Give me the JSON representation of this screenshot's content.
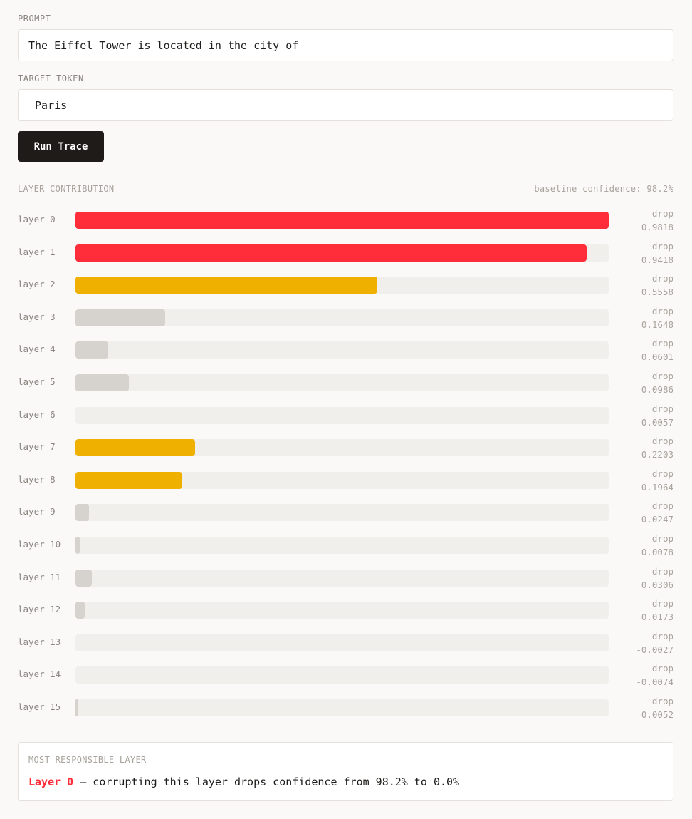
{
  "prompt": {
    "label": "PROMPT",
    "value": "The Eiffel Tower is located in the city of"
  },
  "target": {
    "label": "TARGET TOKEN",
    "value": " Paris"
  },
  "run_button": "Run Trace",
  "contribution": {
    "title": "LAYER CONTRIBUTION",
    "baseline": "baseline confidence: 98.2%",
    "drop_label": "drop",
    "max_drop": 0.9818,
    "colors": {
      "high": "#ff2d3a",
      "medium": "#f0b000",
      "low": "#d6d2ce",
      "track": "#f1efec"
    },
    "layers": [
      {
        "label": "layer 0",
        "drop": "0.9818",
        "value": 0.9818,
        "level": "high"
      },
      {
        "label": "layer 1",
        "drop": "0.9418",
        "value": 0.9418,
        "level": "high"
      },
      {
        "label": "layer 2",
        "drop": "0.5558",
        "value": 0.5558,
        "level": "medium"
      },
      {
        "label": "layer 3",
        "drop": "0.1648",
        "value": 0.1648,
        "level": "low"
      },
      {
        "label": "layer 4",
        "drop": "0.0601",
        "value": 0.0601,
        "level": "low"
      },
      {
        "label": "layer 5",
        "drop": "0.0986",
        "value": 0.0986,
        "level": "low"
      },
      {
        "label": "layer 6",
        "drop": "-0.0057",
        "value": -0.0057,
        "level": "low"
      },
      {
        "label": "layer 7",
        "drop": "0.2203",
        "value": 0.2203,
        "level": "medium"
      },
      {
        "label": "layer 8",
        "drop": "0.1964",
        "value": 0.1964,
        "level": "medium"
      },
      {
        "label": "layer 9",
        "drop": "0.0247",
        "value": 0.0247,
        "level": "low"
      },
      {
        "label": "layer 10",
        "drop": "0.0078",
        "value": 0.0078,
        "level": "low"
      },
      {
        "label": "layer 11",
        "drop": "0.0306",
        "value": 0.0306,
        "level": "low"
      },
      {
        "label": "layer 12",
        "drop": "0.0173",
        "value": 0.0173,
        "level": "low"
      },
      {
        "label": "layer 13",
        "drop": "-0.0027",
        "value": -0.0027,
        "level": "low"
      },
      {
        "label": "layer 14",
        "drop": "-0.0074",
        "value": -0.0074,
        "level": "low"
      },
      {
        "label": "layer 15",
        "drop": "0.0052",
        "value": 0.0052,
        "level": "low"
      }
    ]
  },
  "summary": {
    "title": "MOST RESPONSIBLE LAYER",
    "layer": "Layer 0",
    "text": " — corrupting this layer drops confidence from 98.2% to 0.0%"
  }
}
